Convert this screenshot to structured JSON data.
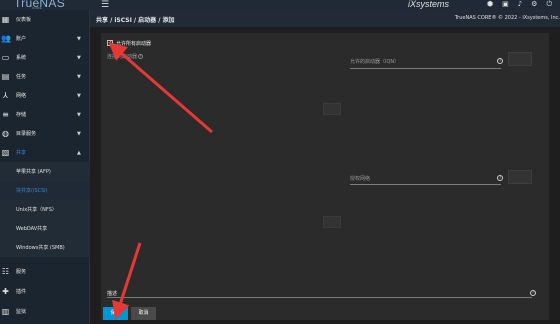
{
  "header": {
    "logo_text": "TrueNAS",
    "logo_sub": "CORE",
    "menu_icon": "menu-icon",
    "brand": "iXsystems",
    "icons": [
      "ix-icon",
      "clipboard-icon",
      "bell-icon",
      "gear-icon",
      "power-icon"
    ]
  },
  "breadcrumb": {
    "path": "共享 / iSCSI / 启动器 / 添加",
    "copyright": "TrueNAS CORE® © 2022 - iXsystems, Inc."
  },
  "sidebar": {
    "items": [
      {
        "label": "仪表板",
        "icon": "dashboard-icon"
      },
      {
        "label": "账户",
        "icon": "accounts-icon"
      },
      {
        "label": "系统",
        "icon": "system-icon"
      },
      {
        "label": "任务",
        "icon": "tasks-icon"
      },
      {
        "label": "网络",
        "icon": "network-icon"
      },
      {
        "label": "存储",
        "icon": "storage-icon"
      },
      {
        "label": "目录服务",
        "icon": "directory-icon"
      },
      {
        "label": "共享",
        "icon": "sharing-icon"
      }
    ],
    "sub_items": [
      {
        "label": "苹果共享 (AFP)"
      },
      {
        "label": "块共享(iSCSI)"
      },
      {
        "label": "Unix共享（NFS）"
      },
      {
        "label": "WebDAV共享"
      },
      {
        "label": "Windows共享 (SMB)"
      }
    ],
    "bottom_items": [
      {
        "label": "服务",
        "icon": "services-icon"
      },
      {
        "label": "插件",
        "icon": "plugins-icon"
      },
      {
        "label": "监狱",
        "icon": "jails-icon"
      }
    ]
  },
  "form": {
    "allow_all_label": "允许所有启动器",
    "allow_all_checked": true,
    "connected_label": "连接的启动器",
    "allowed_initiators_label": "允许的启动器（IQN）",
    "authorized_networks_label": "授权网络",
    "description_label": "描述",
    "save_label": "保存",
    "cancel_label": "取消"
  },
  "colors": {
    "accent": "#0095d5",
    "arrow": "#e53935",
    "active_nav": "#2f8ee0"
  }
}
